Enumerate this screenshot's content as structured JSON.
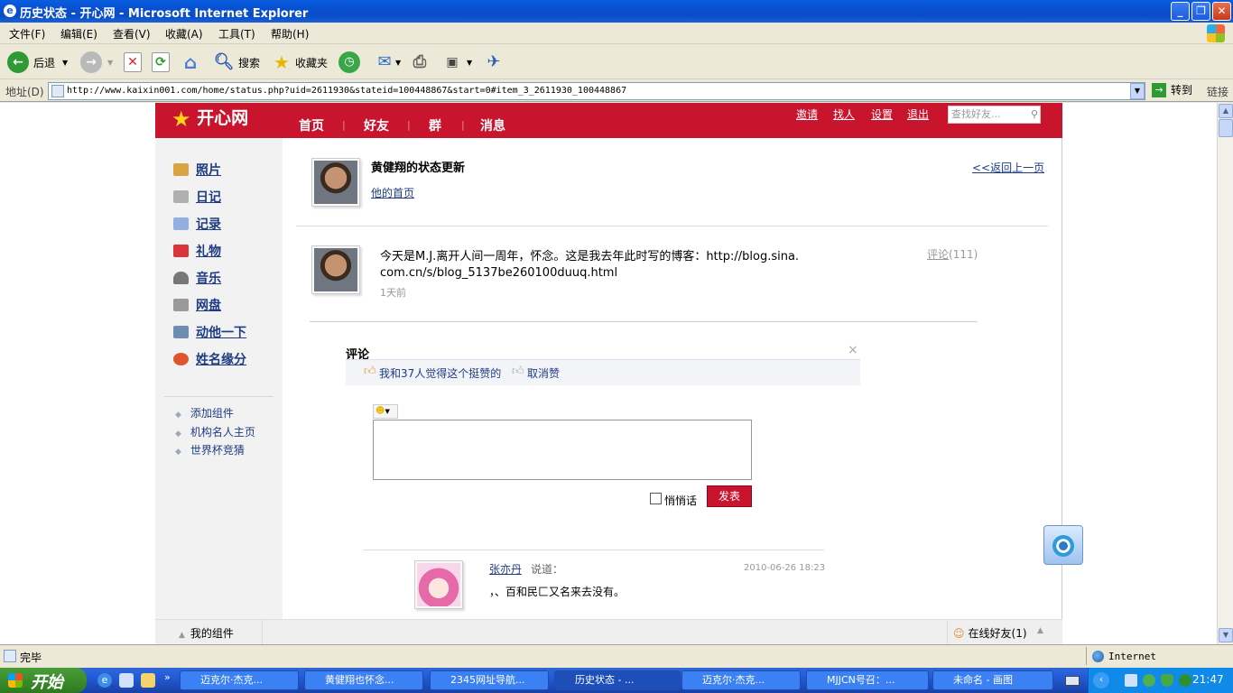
{
  "window": {
    "title": "历史状态 - 开心网 - Microsoft Internet Explorer"
  },
  "menu": [
    "文件(F)",
    "编辑(E)",
    "查看(V)",
    "收藏(A)",
    "工具(T)",
    "帮助(H)"
  ],
  "toolbar": {
    "back": "后退",
    "search": "搜索",
    "favorites": "收藏夹"
  },
  "address": {
    "label": "地址(D)",
    "url": "http://www.kaixin001.com/home/status.php?uid=2611930&stateid=100448867&start=0#item_3_2611930_100448867",
    "go": "转到",
    "links": "链接"
  },
  "site": {
    "logo": "开心网",
    "nav": [
      "首页",
      "好友",
      "群",
      "消息"
    ],
    "top_links": [
      "邀请",
      "找人",
      "设置",
      "退出"
    ],
    "search_placeholder": "查找好友...",
    "sidebar": [
      "照片",
      "日记",
      "记录",
      "礼物",
      "音乐",
      "网盘",
      "动他一下",
      "姓名缘分"
    ],
    "sidebar_sub": [
      "添加组件",
      "机构名人主页",
      "世界杯竞猜"
    ],
    "bottom_left": "我的组件",
    "bottom_right": "在线好友(1)"
  },
  "profile": {
    "title": "黄健翔的状态更新",
    "home_link": "他的首页",
    "back_link": "<<返回上一页"
  },
  "status": {
    "text1": "今天是M.J.离开人间一周年，怀念。这是我去年此时写的博客：http://blog.sina.",
    "text2": "com.cn/s/blog_5137be260100duuq.html",
    "time": "1天前",
    "comment_link": "评论",
    "comment_count": "(111)"
  },
  "comment_box": {
    "header": "评论",
    "close": "×",
    "likes": "我和37人觉得这个挺赞的",
    "unlike": "取消赞",
    "whisper": "悄悄话",
    "submit": "发表"
  },
  "comment": {
    "author": "张亦丹",
    "said": "说道：",
    "time": "2010-06-26 18:23",
    "text": "，、百和民匚又名来去没有。"
  },
  "statusbar": {
    "text": "完毕",
    "zone": "Internet"
  },
  "taskbar": {
    "start": "开始",
    "tasks": [
      "迈克尔·杰克...",
      "黄健翔也怀念...",
      "2345网址导航...",
      "历史状态 - ...",
      "迈克尔·杰克...",
      "MJJCN号召：...",
      "未命名 - 画图"
    ],
    "clock": "21:47"
  }
}
